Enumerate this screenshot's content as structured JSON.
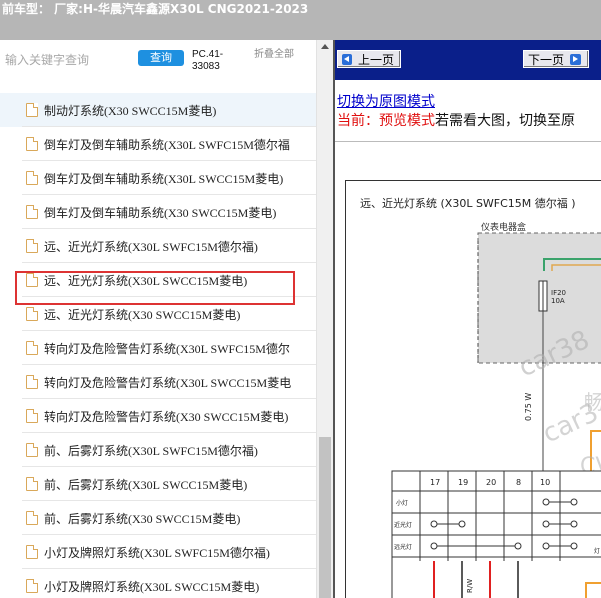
{
  "header": {
    "title": "前车型： 厂家:H-华晨汽车鑫源X30L CNG2021-2023"
  },
  "search": {
    "placeholder": "输入关键字查询",
    "button_label": "查询",
    "code": "PC.41-33083",
    "collapse_label": "折叠全部"
  },
  "list": {
    "items": [
      {
        "label": "制动灯系统(X30 SWCC15M菱电)"
      },
      {
        "label": "倒车灯及倒车辅助系统(X30L SWFC15M德尔福"
      },
      {
        "label": "倒车灯及倒车辅助系统(X30L SWCC15M菱电)"
      },
      {
        "label": "倒车灯及倒车辅助系统(X30 SWCC15M菱电)"
      },
      {
        "label": "远、近光灯系统(X30L SWFC15M德尔福)"
      },
      {
        "label": "远、近光灯系统(X30L SWCC15M菱电)"
      },
      {
        "label": "远、近光灯系统(X30 SWCC15M菱电)"
      },
      {
        "label": "转向灯及危险警告灯系统(X30L SWFC15M德尔"
      },
      {
        "label": "转向灯及危险警告灯系统(X30L SWCC15M菱电"
      },
      {
        "label": "转向灯及危险警告灯系统(X30 SWCC15M菱电)"
      },
      {
        "label": "前、后雾灯系统(X30L SWFC15M德尔福)"
      },
      {
        "label": "前、后雾灯系统(X30L SWCC15M菱电)"
      },
      {
        "label": "前、后雾灯系统(X30 SWCC15M菱电)"
      },
      {
        "label": "小灯及牌照灯系统(X30L SWFC15M德尔福)"
      },
      {
        "label": "小灯及牌照灯系统(X30L SWCC15M菱电)"
      }
    ]
  },
  "nav": {
    "prev_label": "上一页",
    "next_label": "下一页"
  },
  "preview": {
    "switch_link": "切换为原图模式",
    "current_prefix": "当前：",
    "current_mode": "预览模式",
    "current_suffix": "若需看大图，切换至原",
    "diagram_title": "远、近光灯系统 (X30L SWFC15M 德尔福 )",
    "dash_box_label": "仪表电器盒",
    "fuse_label": "IF20",
    "fuse_rating": "10A",
    "wire_label": "0.75 W",
    "watermark_1": "car38",
    "watermark_2": "car3",
    "table_headers": [
      "17",
      "19",
      "20",
      "8",
      "10"
    ],
    "row_labels": [
      "小灯",
      "近光灯",
      "远光灯"
    ],
    "wire_bottom": "R/W",
    "side_text": "灯",
    "watermark_char": "畅",
    "watermark_letters": "CV"
  },
  "colors": {
    "accent_blue": "#1e90e0",
    "nav_bg": "#0a1f8a",
    "highlight_red": "#d33333",
    "current_red": "#e01010"
  }
}
